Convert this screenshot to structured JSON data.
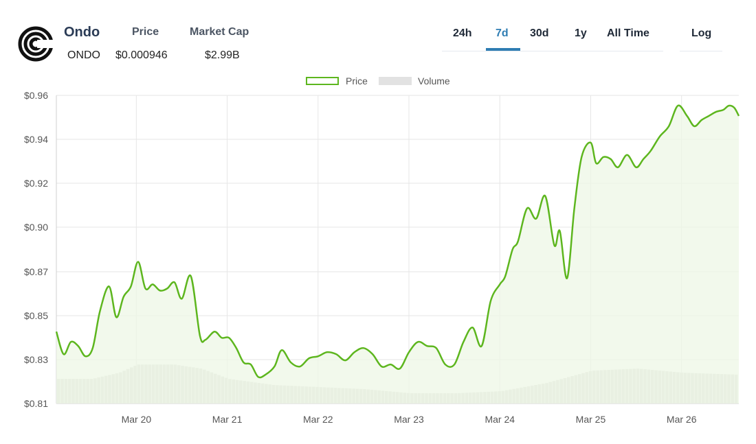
{
  "coin": {
    "name": "Ondo",
    "symbol": "ONDO",
    "price_label": "Price",
    "price_value": "$0.000946",
    "mcap_label": "Market Cap",
    "mcap_value": "$2.99B"
  },
  "tabs": [
    {
      "label": "24h",
      "active": false
    },
    {
      "label": "7d",
      "active": true
    },
    {
      "label": "30d",
      "active": false
    },
    {
      "label": "1y",
      "active": false
    },
    {
      "label": "All Time",
      "active": false
    }
  ],
  "log_label": "Log",
  "colors": {
    "accent": "#2f7db3",
    "price_line": "#5db61e",
    "price_fill": "#eef7e6",
    "volume": "#d9dcd6"
  },
  "chart_data": {
    "type": "line",
    "legend": [
      "Price",
      "Volume"
    ],
    "legend_position": "top-center",
    "grid": true,
    "x_tick_labels": [
      "Mar 20",
      "Mar 21",
      "Mar 22",
      "Mar 23",
      "Mar 24",
      "Mar 25",
      "Mar 26"
    ],
    "y_tick_labels": [
      "$0.96",
      "$0.94",
      "$0.92",
      "$0.90",
      "$0.87",
      "$0.85",
      "$0.83",
      "$0.81"
    ],
    "ylim": [
      0.81,
      0.96
    ],
    "xlim": [
      19.12,
      26.63
    ],
    "series": [
      {
        "name": "Price",
        "x": [
          19.12,
          19.2,
          19.28,
          19.36,
          19.44,
          19.52,
          19.6,
          19.7,
          19.78,
          19.86,
          19.94,
          20.02,
          20.1,
          20.18,
          20.26,
          20.34,
          20.42,
          20.5,
          20.6,
          20.7,
          20.76,
          20.86,
          20.94,
          21.02,
          21.1,
          21.18,
          21.26,
          21.34,
          21.42,
          21.52,
          21.6,
          21.7,
          21.8,
          21.9,
          22.0,
          22.1,
          22.2,
          22.3,
          22.4,
          22.5,
          22.6,
          22.7,
          22.8,
          22.9,
          23.0,
          23.1,
          23.2,
          23.3,
          23.4,
          23.5,
          23.6,
          23.7,
          23.8,
          23.9,
          24.0,
          24.06,
          24.14,
          24.2,
          24.3,
          24.4,
          24.5,
          24.6,
          24.66,
          24.74,
          24.82,
          24.9,
          25.0,
          25.06,
          25.14,
          25.22,
          25.3,
          25.4,
          25.5,
          25.58,
          25.66,
          25.76,
          25.86,
          25.96,
          26.06,
          26.14,
          26.22,
          26.3,
          26.38,
          26.46,
          26.52,
          26.58,
          26.63
        ],
        "values": [
          0.845,
          0.834,
          0.84,
          0.838,
          0.833,
          0.837,
          0.855,
          0.867,
          0.852,
          0.862,
          0.867,
          0.879,
          0.866,
          0.868,
          0.865,
          0.866,
          0.869,
          0.861,
          0.872,
          0.843,
          0.841,
          0.845,
          0.842,
          0.842,
          0.837,
          0.83,
          0.829,
          0.823,
          0.824,
          0.828,
          0.836,
          0.83,
          0.828,
          0.832,
          0.833,
          0.835,
          0.834,
          0.831,
          0.835,
          0.837,
          0.834,
          0.828,
          0.829,
          0.827,
          0.835,
          0.84,
          0.838,
          0.837,
          0.829,
          0.829,
          0.84,
          0.847,
          0.838,
          0.86,
          0.868,
          0.872,
          0.885,
          0.889,
          0.905,
          0.9,
          0.911,
          0.887,
          0.894,
          0.871,
          0.905,
          0.93,
          0.937,
          0.927,
          0.93,
          0.929,
          0.925,
          0.931,
          0.925,
          0.929,
          0.933,
          0.94,
          0.945,
          0.955,
          0.95,
          0.945,
          0.948,
          0.95,
          0.952,
          0.953,
          0.955,
          0.954,
          0.95
        ]
      },
      {
        "name": "Volume",
        "x": [
          19.12,
          19.5,
          19.8,
          20.0,
          20.4,
          20.7,
          21.0,
          21.5,
          22.0,
          22.5,
          23.0,
          23.5,
          24.0,
          24.5,
          25.0,
          25.5,
          26.0,
          26.63
        ],
        "values": [
          0.822,
          0.822,
          0.825,
          0.829,
          0.829,
          0.827,
          0.822,
          0.819,
          0.818,
          0.817,
          0.815,
          0.815,
          0.816,
          0.82,
          0.826,
          0.827,
          0.825,
          0.824
        ]
      }
    ]
  }
}
